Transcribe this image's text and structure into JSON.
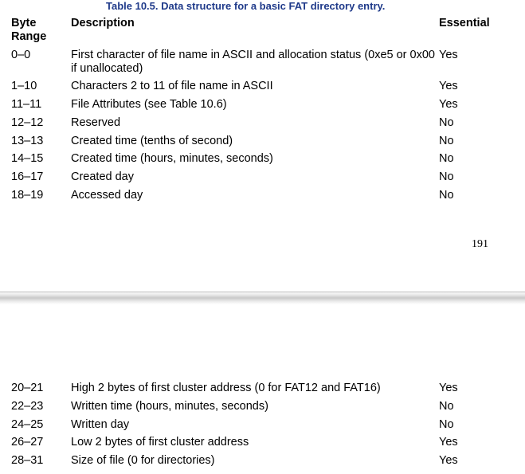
{
  "caption": "Table 10.5. Data structure for a basic FAT directory entry.",
  "headers": {
    "range_line1": "Byte",
    "range_line2": "Range",
    "description": "Description",
    "essential": "Essential"
  },
  "rows_top": [
    {
      "range": "0–0",
      "description": "First character of file name in ASCII and allocation status (0xe5 or 0x00 if unallocated)",
      "essential": "Yes"
    },
    {
      "range": "1–10",
      "description": "Characters 2 to 11 of file name in ASCII",
      "essential": "Yes"
    },
    {
      "range": "11–11",
      "description": "File Attributes (see Table 10.6)",
      "essential": "Yes"
    },
    {
      "range": "12–12",
      "description": "Reserved",
      "essential": "No"
    },
    {
      "range": "13–13",
      "description": "Created time (tenths of second)",
      "essential": "No"
    },
    {
      "range": "14–15",
      "description": "Created time (hours, minutes, seconds)",
      "essential": "No"
    },
    {
      "range": "16–17",
      "description": "Created day",
      "essential": "No"
    },
    {
      "range": "18–19",
      "description": "Accessed day",
      "essential": "No"
    }
  ],
  "page_number": "191",
  "rows_bottom": [
    {
      "range": "20–21",
      "description": "High 2 bytes of first cluster address (0 for FAT12 and FAT16)",
      "essential": "Yes"
    },
    {
      "range": "22–23",
      "description": "Written time (hours, minutes, seconds)",
      "essential": "No"
    },
    {
      "range": "24–25",
      "description": "Written day",
      "essential": "No"
    },
    {
      "range": "26–27",
      "description": "Low 2 bytes of first cluster address",
      "essential": "Yes"
    },
    {
      "range": "28–31",
      "description": "Size of file (0 for directories)",
      "essential": "Yes"
    }
  ]
}
